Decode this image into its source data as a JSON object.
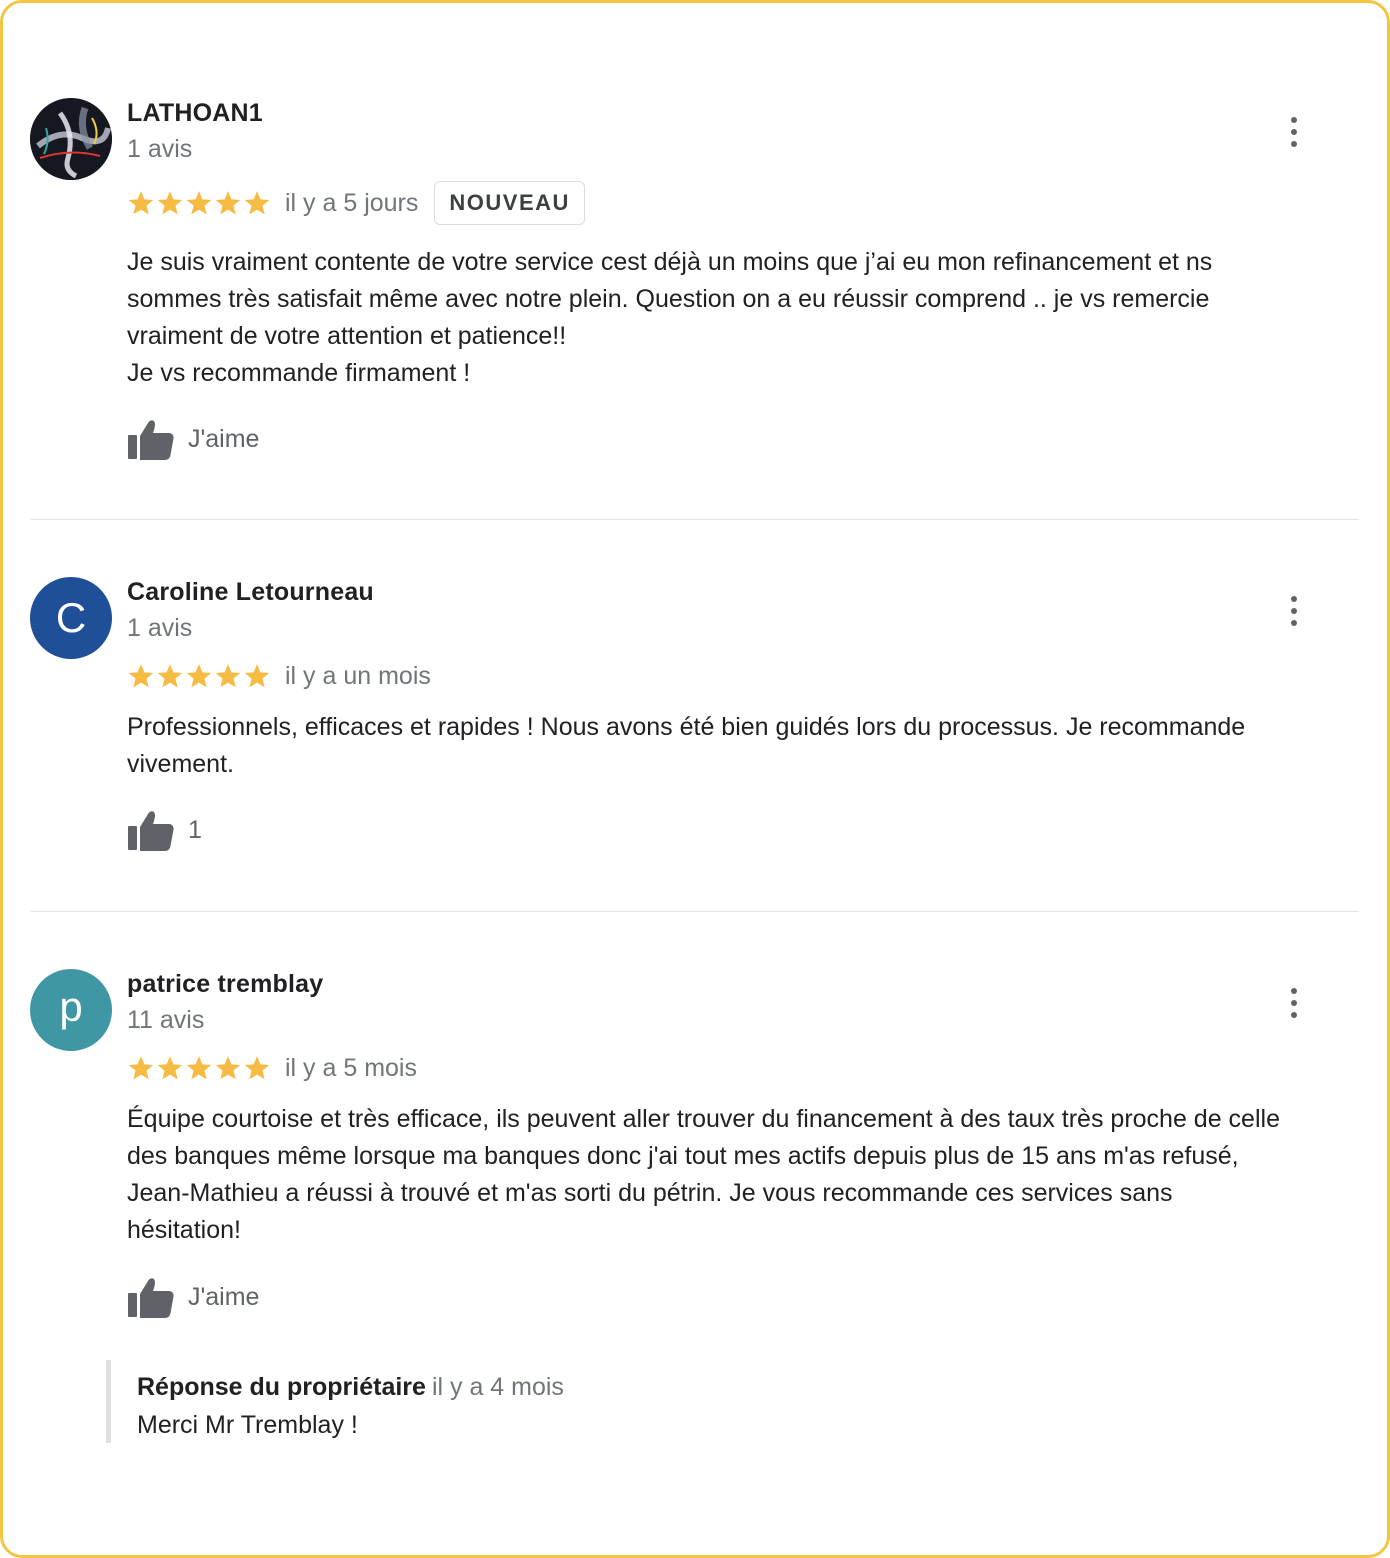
{
  "reviews": [
    {
      "author": "LATHOAN1",
      "review_count": "1 avis",
      "rating": 5,
      "date": "il y a 5 jours",
      "badge": "NOUVEAU",
      "text": "Je suis vraiment contente de votre service cest déjà un moins que j’ai eu mon refinancement et ns\nsommes très satisfait même avec notre plein. Question on a eu réussir comprend .. je vs remercie\nvraiment de votre attention et patience!!\nJe vs recommande firmament !",
      "like_label": "J'aime",
      "avatar": {
        "type": "photo"
      }
    },
    {
      "author": "Caroline Letourneau",
      "review_count": "1 avis",
      "rating": 5,
      "date": "il y a un mois",
      "text": "Professionnels, efficaces et rapides ! Nous avons été bien guidés lors du processus. Je recommande\nvivement.",
      "like_label": "1",
      "avatar": {
        "type": "letter",
        "letter": "C",
        "color": "#1f4f96"
      }
    },
    {
      "author": "patrice tremblay",
      "review_count": "11 avis",
      "rating": 5,
      "date": "il y a 5 mois",
      "text": "Équipe courtoise et très efficace, ils peuvent aller trouver du financement à des taux très proche de celle\ndes banques même lorsque ma banques donc j'ai tout mes actifs depuis plus de 15 ans m'as refusé,\nJean-Mathieu a réussi à trouvé et m'as sorti du pétrin. Je vous recommande ces services sans\nhésitation!",
      "like_label": "J'aime",
      "avatar": {
        "type": "letter",
        "letter": "p",
        "color": "#3f97a3"
      },
      "owner_reply": {
        "title": "Réponse du propriétaire",
        "date": "il y a 4 mois",
        "text": "Merci Mr Tremblay !"
      }
    }
  ],
  "colors": {
    "frame_border": "#f4c542",
    "star": "#f6bb42",
    "icon_gray": "#5f6368"
  },
  "icons": {
    "star": "star-icon",
    "like": "thumbs-up-icon",
    "more": "more-vert-icon"
  }
}
